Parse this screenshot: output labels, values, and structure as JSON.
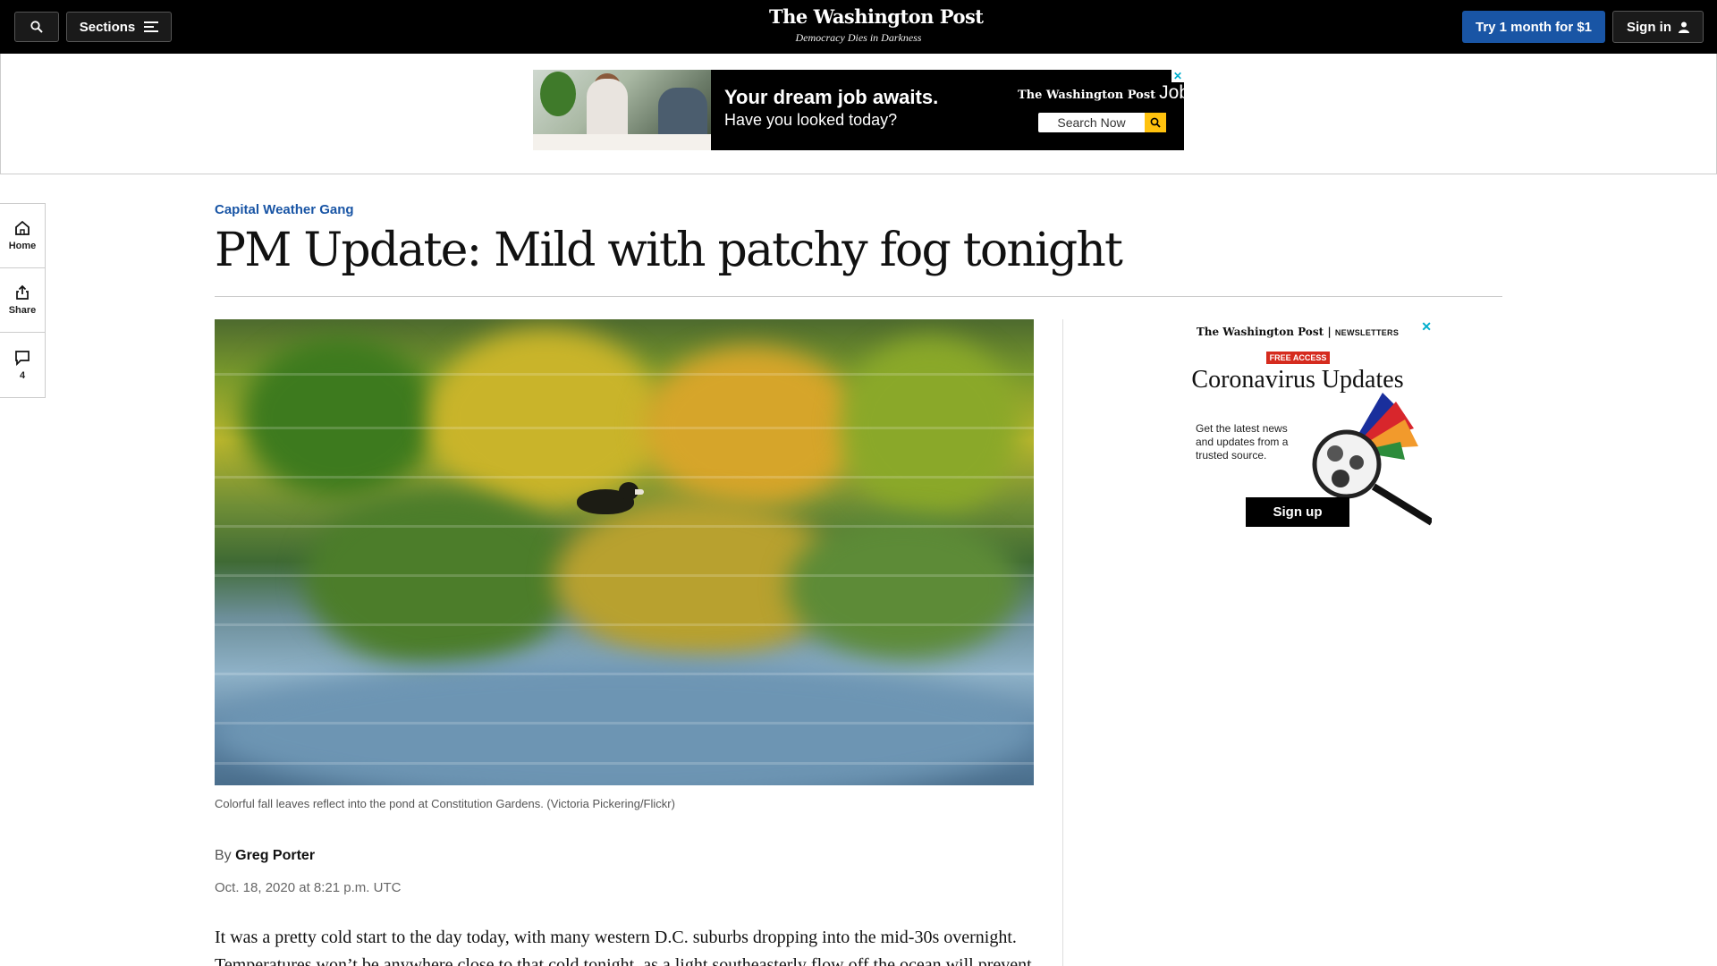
{
  "topbar": {
    "sections_label": "Sections",
    "logo": "The Washington Post",
    "tagline": "Democracy Dies in Darkness",
    "try_label": "Try 1 month for $1",
    "signin_label": "Sign in"
  },
  "top_ad": {
    "headline": "Your dream job awaits.",
    "subline": "Have you looked today?",
    "brand": "The Washington Post",
    "brand_suffix": "Jobs",
    "search_label": "Search Now"
  },
  "left_rail": {
    "home_label": "Home",
    "share_label": "Share",
    "comments_count": "4"
  },
  "article": {
    "kicker": "Capital Weather Gang",
    "headline": "PM Update: Mild with patchy fog tonight",
    "caption": "Colorful fall leaves reflect into the pond at Constitution Gardens. (Victoria Pickering/Flickr)",
    "by_prefix": "By",
    "author": "Greg Porter",
    "dateline": "Oct. 18, 2020 at 8:21 p.m. UTC",
    "body": "It was a pretty cold start to the day today, with many western D.C. suburbs dropping into the mid-30s overnight. Temperatures won’t be anywhere close to that cold tonight, as a light southeasterly flow off the ocean will prevent"
  },
  "side_ad": {
    "brand": "The Washington Post",
    "brand_suffix": "NEWSLETTERS",
    "badge": "FREE ACCESS",
    "title": "Coronavirus Updates",
    "body": "Get the latest news and updates from a trusted source.",
    "cta": "Sign up"
  }
}
